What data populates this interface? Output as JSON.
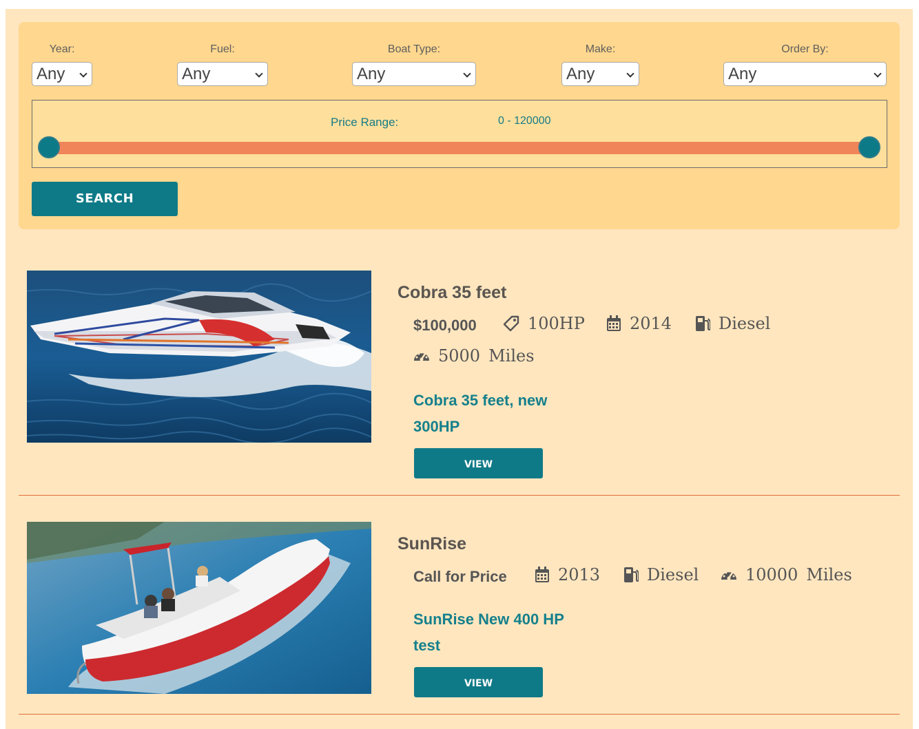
{
  "filters": {
    "year": {
      "label": "Year:",
      "value": "Any"
    },
    "fuel": {
      "label": "Fuel:",
      "value": "Any"
    },
    "boat_type": {
      "label": "Boat Type:",
      "value": "Any"
    },
    "make": {
      "label": "Make:",
      "value": "Any"
    },
    "order_by": {
      "label": "Order By:",
      "value": "Any"
    },
    "price_range": {
      "label": "Price Range:",
      "value": "0 - 120000",
      "min": 0,
      "max": 120000
    },
    "search_label": "SEARCH"
  },
  "listings": [
    {
      "title": "Cobra 35 feet",
      "price": "$100,000",
      "horsepower": "100HP",
      "year": "2014",
      "fuel": "Diesel",
      "miles": "5000",
      "miles_unit": "Miles",
      "description": "Cobra 35 feet, new 300HP",
      "view_label": "VIEW"
    },
    {
      "title": "SunRise",
      "price": "Call for Price",
      "year": "2013",
      "fuel": "Diesel",
      "miles": "10000",
      "miles_unit": "Miles",
      "description": "SunRise New 400 HP test",
      "view_label": "VIEW"
    }
  ],
  "colors": {
    "page_bg": "#ffe6bf",
    "panel_bg": "#ffd78e",
    "accent_teal": "#0f7a87",
    "slider_track": "#f0855a",
    "divider": "#e06e37"
  },
  "icons": {
    "horsepower": "tag-icon",
    "year": "calendar-icon",
    "fuel": "fuel-pump-icon",
    "miles": "speedometer-icon"
  }
}
